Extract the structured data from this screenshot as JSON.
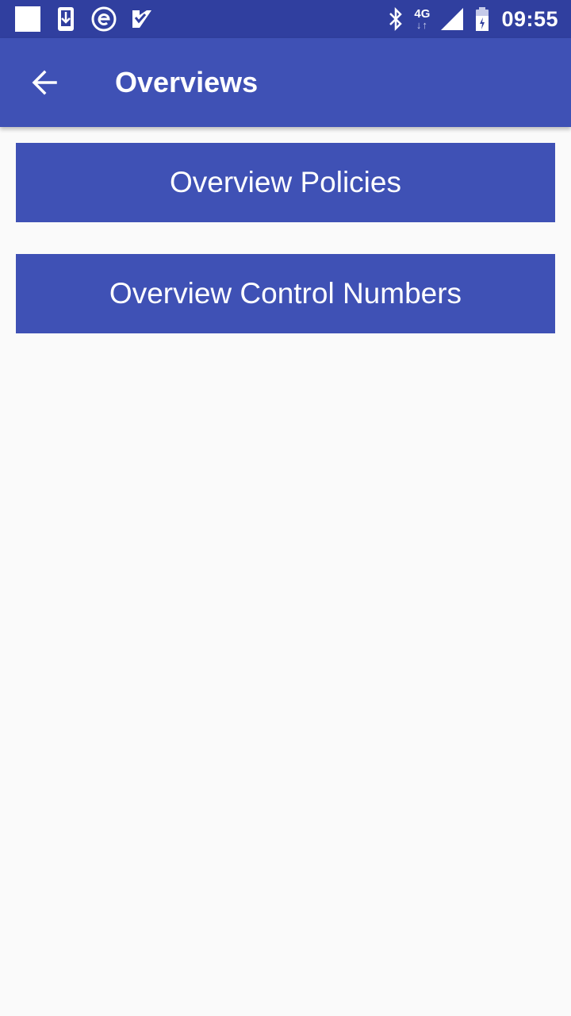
{
  "status_bar": {
    "time": "09:55",
    "network_type": "4G",
    "left_icons": [
      "notification-square-icon",
      "download-icon",
      "e-app-icon",
      "checklist-app-icon"
    ],
    "right_icons": [
      "bluetooth-icon",
      "network-4g-icon",
      "signal-icon",
      "battery-icon"
    ]
  },
  "app_bar": {
    "title": "Overviews",
    "back_icon": "back-arrow-icon"
  },
  "buttons": {
    "policies_label": "Overview Policies",
    "control_numbers_label": "Overview Control Numbers"
  },
  "colors": {
    "status_bar": "#303f9f",
    "app_bar": "#3f51b5",
    "button": "#3f51b5",
    "background": "#fafafa",
    "text_on_primary": "#ffffff"
  }
}
